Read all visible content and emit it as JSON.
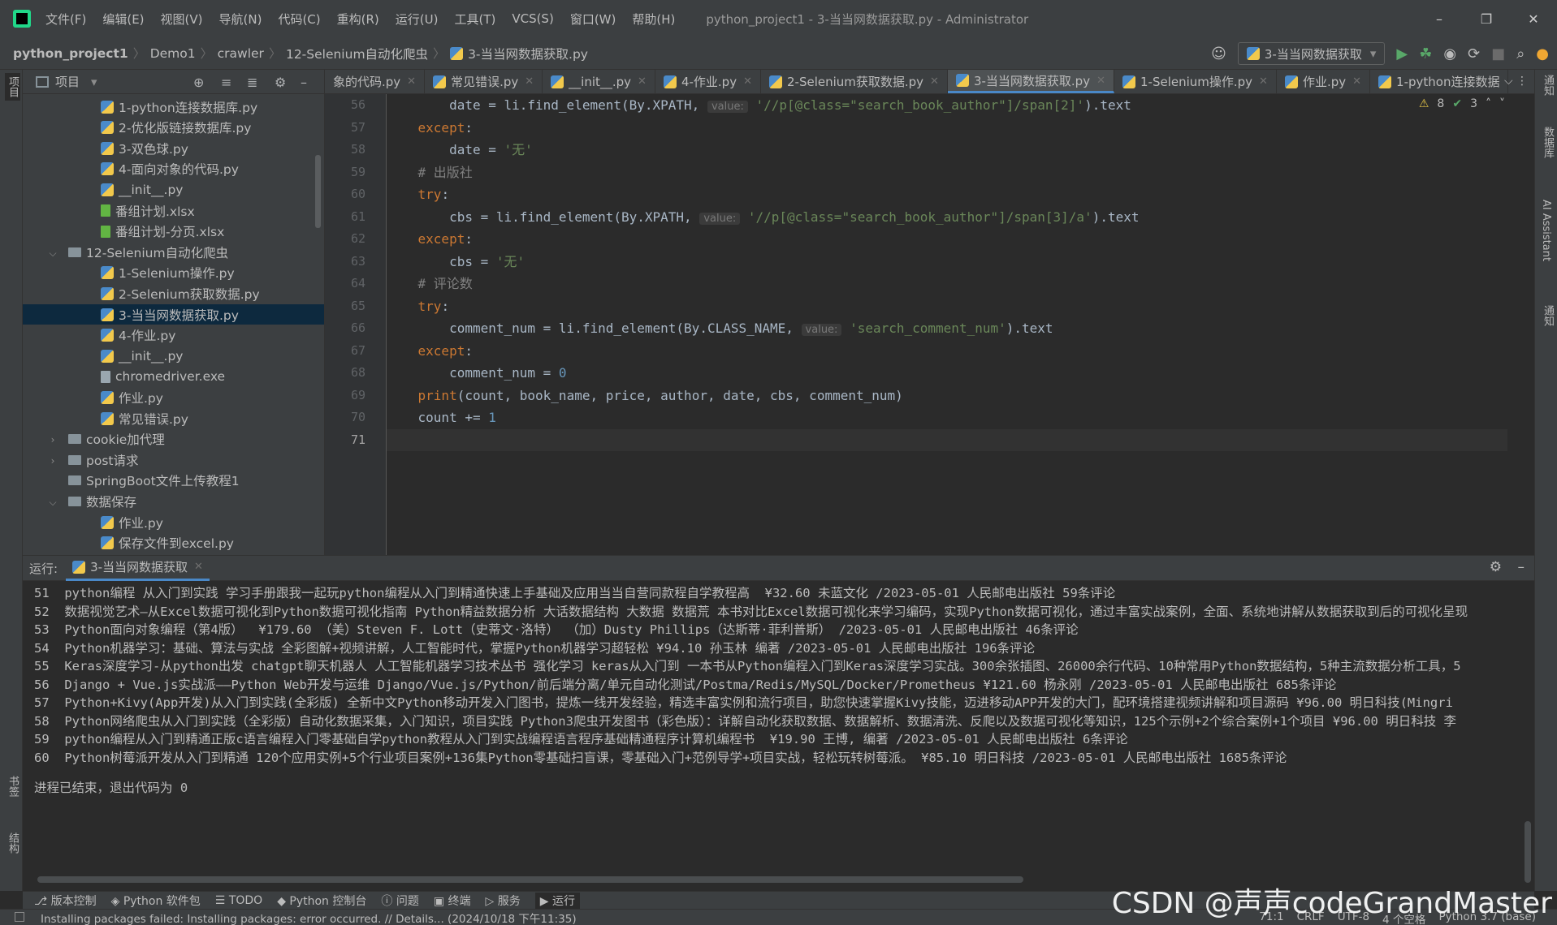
{
  "menu": [
    "文件(F)",
    "编辑(E)",
    "视图(V)",
    "导航(N)",
    "代码(C)",
    "重构(R)",
    "运行(U)",
    "工具(T)",
    "VCS(S)",
    "窗口(W)",
    "帮助(H)"
  ],
  "window_title": "python_project1 - 3-当当网数据获取.py - Administrator",
  "breadcrumb": [
    "python_project1",
    "Demo1",
    "crawler",
    "12-Selenium自动化爬虫",
    "3-当当网数据获取.py"
  ],
  "run_config": "3-当当网数据获取",
  "project_panel": {
    "title": "项目",
    "tree": [
      {
        "label": "1-python连接数据库.py",
        "type": "py",
        "indent": 2
      },
      {
        "label": "2-优化版链接数据库.py",
        "type": "py",
        "indent": 2
      },
      {
        "label": "3-双色球.py",
        "type": "py",
        "indent": 2
      },
      {
        "label": "4-面向对象的代码.py",
        "type": "py",
        "indent": 2
      },
      {
        "label": "__init__.py",
        "type": "py",
        "indent": 2
      },
      {
        "label": "番组计划.xlsx",
        "type": "xlsx",
        "indent": 2
      },
      {
        "label": "番组计划-分页.xlsx",
        "type": "xlsx",
        "indent": 2
      },
      {
        "label": "12-Selenium自动化爬虫",
        "type": "folder-open",
        "indent": 1
      },
      {
        "label": "1-Selenium操作.py",
        "type": "py",
        "indent": 2
      },
      {
        "label": "2-Selenium获取数据.py",
        "type": "py",
        "indent": 2
      },
      {
        "label": "3-当当网数据获取.py",
        "type": "py",
        "indent": 2,
        "selected": true
      },
      {
        "label": "4-作业.py",
        "type": "py",
        "indent": 2
      },
      {
        "label": "__init__.py",
        "type": "py",
        "indent": 2
      },
      {
        "label": "chromedriver.exe",
        "type": "exe",
        "indent": 2
      },
      {
        "label": "作业.py",
        "type": "py",
        "indent": 2
      },
      {
        "label": "常见错误.py",
        "type": "py",
        "indent": 2
      },
      {
        "label": "cookie加代理",
        "type": "folder-closed",
        "indent": 1
      },
      {
        "label": "post请求",
        "type": "folder-closed",
        "indent": 1
      },
      {
        "label": "SpringBoot文件上传教程1",
        "type": "folder",
        "indent": 1
      },
      {
        "label": "数据保存",
        "type": "folder-open",
        "indent": 1
      },
      {
        "label": "作业.py",
        "type": "py",
        "indent": 2
      },
      {
        "label": "保存文件到excel.py",
        "type": "py",
        "indent": 2
      },
      {
        "label": "动漫信息.xlsx",
        "type": "xlsx",
        "indent": 2
      }
    ]
  },
  "tabs": [
    {
      "label": "象的代码.py",
      "active": false
    },
    {
      "label": "常见错误.py",
      "active": false
    },
    {
      "label": "__init__.py",
      "active": false
    },
    {
      "label": "4-作业.py",
      "active": false
    },
    {
      "label": "2-Selenium获取数据.py",
      "active": false
    },
    {
      "label": "3-当当网数据获取.py",
      "active": true
    },
    {
      "label": "1-Selenium操作.py",
      "active": false
    },
    {
      "label": "作业.py",
      "active": false
    },
    {
      "label": "1-python连接数据",
      "active": false
    }
  ],
  "inspection": {
    "warnings": "8",
    "ok": "3"
  },
  "code": {
    "line_numbers": [
      "56",
      "57",
      "58",
      "59",
      "60",
      "61",
      "62",
      "63",
      "64",
      "65",
      "66",
      "67",
      "68",
      "69",
      "70",
      "71"
    ],
    "current_line": "71"
  },
  "run_panel": {
    "label": "运行:",
    "tab": "3-当当网数据获取",
    "output": [
      "51  python编程 从入门到实践 学习手册跟我一起玩python编程从入门到精通快速上手基础及应用当当自营同款程自学教程高  ¥32.60 未蓝文化 /2023-05-01 人民邮电出版社 59条评论",
      "52  数据视觉艺术—从Excel数据可视化到Python数据可视化指南 Python精益数据分析 大话数据结构 大数据 数据荒 本书对比Excel数据可视化来学习编码，实现Python数据可视化，通过丰富实战案例，全面、系统地讲解从数据获取到后的可视化呈现",
      "53  Python面向对象编程（第4版）  ¥179.60 （美）Steven F. Lott（史蒂文·洛特） （加）Dusty Phillips（达斯蒂·菲利普斯） /2023-05-01 人民邮电出版社 46条评论",
      "54  Python机器学习：基础、算法与实战 全彩图解+视频讲解，人工智能时代，掌握Python机器学习超轻松 ¥94.10 孙玉林 编著 /2023-05-01 人民邮电出版社 196条评论",
      "55  Keras深度学习-从python出发 chatgpt聊天机器人 人工智能机器学习技术丛书 强化学习 keras从入门到 一本书从Python编程入门到Keras深度学习实战。300余张插图、26000余行代码、10种常用Python数据结构，5种主流数据分析工具，5",
      "56  Django + Vue.js实战派——Python Web开发与运维 Django/Vue.js/Python/前后端分离/单元自动化测试/Postma/Redis/MySQL/Docker/Prometheus ¥121.60 杨永刚 /2023-05-01 人民邮电出版社 685条评论",
      "57  Python+Kivy(App开发)从入门到实践(全彩版) 全新中文Python移动开发入门图书，提炼一线开发经验，精选丰富实例和流行项目，助您快速掌握Kivy技能，迈进移动APP开发的大门，配环境搭建视频讲解和项目源码 ¥96.00 明日科技(Mingri",
      "58  Python网络爬虫从入门到实践（全彩版）自动化数据采集，入门知识，项目实践 Python3爬虫开发图书（彩色版）：详解自动化获取数据、数据解析、数据清洗、反爬以及数据可视化等知识，125个示例+2个综合案例+1个项目 ¥96.00 明日科技 李",
      "59  python编程从入门到精通正版c语言编程入门零基础自学python教程从入门到实战编程语言程序基础精通程序计算机编程书  ¥19.90 王博, 编著 /2023-05-01 人民邮电出版社 6条评论",
      "60  Python树莓派开发从入门到精通 120个应用实例+5个行业项目案例+136集Python零基础扫盲课，零基础入门+范例导学+项目实战，轻松玩转树莓派。 ¥85.10 明日科技 /2023-05-01 人民邮电出版社 1685条评论"
    ],
    "exit_message": "进程已结束，退出代码为 0"
  },
  "bottom_tools": [
    "版本控制",
    "Python 软件包",
    "TODO",
    "Python 控制台",
    "问题",
    "终端",
    "服务",
    "运行"
  ],
  "left_strip": [
    "项目",
    "书签",
    "结构"
  ],
  "right_strip": [
    "通知",
    "数据库",
    "AI Assistant",
    "通知"
  ],
  "status": {
    "message": "Installing packages failed: Installing packages: error occurred. // Details... (2024/10/18 下午11:35)",
    "position": "71:1",
    "line_sep": "CRLF",
    "encoding": "UTF-8",
    "indent": "4 个空格",
    "interpreter": "Python 3.7 (base)"
  },
  "watermark": "CSDN @声声codeGrandMaster"
}
